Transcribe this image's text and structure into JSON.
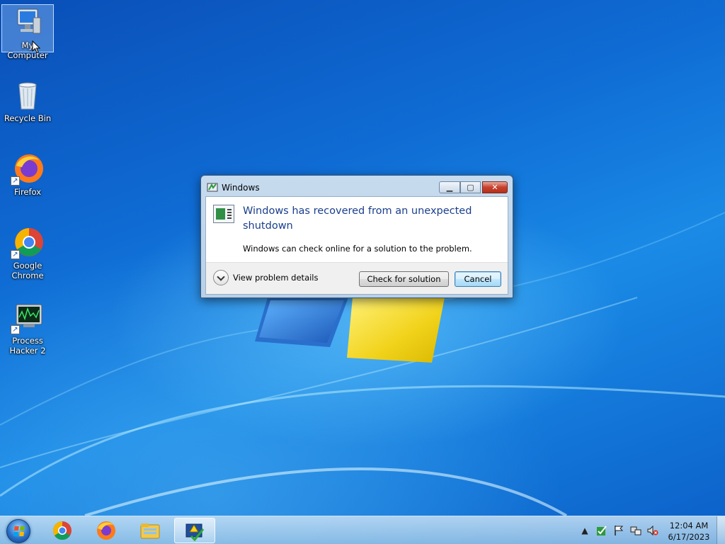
{
  "desktop": {
    "icons": [
      {
        "label": "My Computer"
      },
      {
        "label": "Recycle Bin"
      },
      {
        "label": "Firefox"
      },
      {
        "label": "Google Chrome"
      },
      {
        "label": "Process Hacker 2"
      }
    ]
  },
  "dialog": {
    "title": "Windows",
    "headline": "Windows has recovered from an unexpected shutdown",
    "body": "Windows can check online for a solution to the problem.",
    "details_label": "View problem details",
    "check_button": "Check for solution",
    "cancel_button": "Cancel"
  },
  "taskbar": {
    "apps": [
      {
        "icon": "chrome-icon"
      },
      {
        "icon": "firefox-icon"
      },
      {
        "icon": "file-explorer-icon"
      },
      {
        "icon": "action-center-icon",
        "active": true
      }
    ],
    "tray": {
      "icons": [
        "show-hidden-icons-chevron",
        "shield-check-icon",
        "action-center-flag-icon",
        "network-icon",
        "volume-muted-icon"
      ],
      "time": "12:04 AM",
      "date": "6/17/2023"
    }
  },
  "colors": {
    "headline": "#1a3e8c",
    "desktop": "#0f6cd4"
  }
}
